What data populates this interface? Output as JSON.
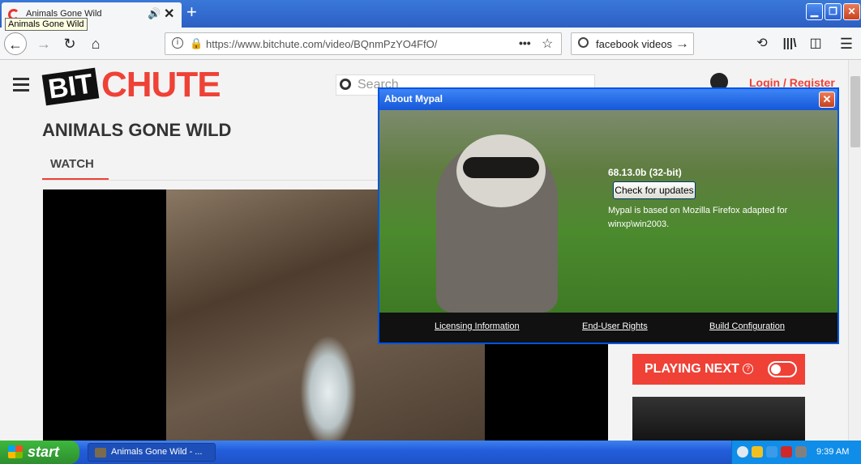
{
  "browser": {
    "tab_title": "Animals Gone Wild",
    "tooltip": "Animals Gone Wild",
    "new_tab": "+",
    "url": "https://www.bitchute.com/video/BQnmPzYO4FfO/",
    "search_value": "facebook videos"
  },
  "site": {
    "logo_bit": "BIT",
    "logo_chute": "CHUTE",
    "search_placeholder": "Search",
    "login": "Login / Register",
    "video_title": "ANIMALS GONE WILD",
    "tab_watch": "WATCH",
    "playing_next": "PLAYING NEXT"
  },
  "about": {
    "title": "About Mypal",
    "version": "68.13.0b (32-bit)",
    "check_updates": "Check for updates",
    "description": "Mypal is based on Mozilla Firefox adapted for winxp\\win2003.",
    "links": [
      "Licensing Information",
      "End-User Rights",
      "Build Configuration"
    ]
  },
  "taskbar": {
    "start": "start",
    "task_label": "Animals Gone Wild - ...",
    "clock": "9:39 AM"
  },
  "colors": {
    "accent": "#ef4136",
    "xp_blue": "#245edc",
    "start_green": "#3db83d"
  }
}
